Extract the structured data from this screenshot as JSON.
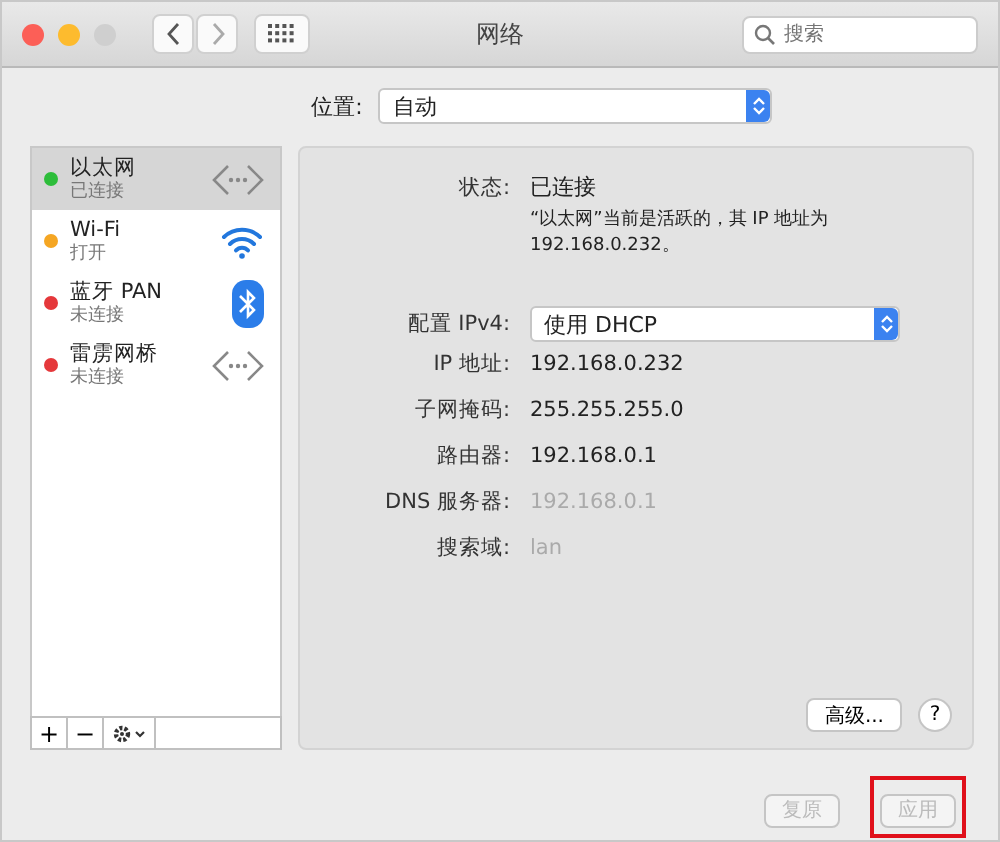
{
  "window": {
    "title": "网络",
    "search": {
      "placeholder": "搜索"
    }
  },
  "location": {
    "label": "位置:",
    "value": "自动"
  },
  "services": [
    {
      "name": "以太网",
      "status": "已连接",
      "color": "#2dbd3a",
      "kind": "ethernet",
      "selected": true
    },
    {
      "name": "Wi-Fi",
      "status": "打开",
      "color": "#f5a623",
      "kind": "wifi",
      "selected": false
    },
    {
      "name": "蓝牙 PAN",
      "status": "未连接",
      "color": "#e5383b",
      "kind": "bluetooth",
      "selected": false
    },
    {
      "name": "雷雳网桥",
      "status": "未连接",
      "color": "#e5383b",
      "kind": "ethernet",
      "selected": false
    }
  ],
  "list_toolbar": [
    "+",
    "−"
  ],
  "details": {
    "status_label": "状态:",
    "status_value": "已连接",
    "status_note": "“以太网”当前是活跃的，其 IP 地址为 192.168.0.232。",
    "config_label": "配置 IPv4:",
    "config_value": "使用 DHCP",
    "fields": [
      {
        "label": "IP 地址:",
        "value": "192.168.0.232",
        "dimmed": false
      },
      {
        "label": "子网掩码:",
        "value": "255.255.255.0",
        "dimmed": false
      },
      {
        "label": "路由器:",
        "value": "192.168.0.1",
        "dimmed": false
      },
      {
        "label": "DNS 服务器:",
        "value": "192.168.0.1",
        "dimmed": true
      },
      {
        "label": "搜索域:",
        "value": "lan",
        "dimmed": true
      }
    ],
    "advanced": "高级...",
    "help": "?"
  },
  "buttons": [
    {
      "label": "复原",
      "disabled": true,
      "highlighted": false
    },
    {
      "label": "应用",
      "disabled": true,
      "highlighted": true
    }
  ]
}
